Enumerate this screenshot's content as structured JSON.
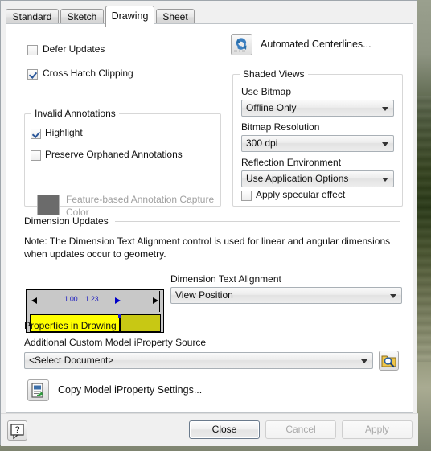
{
  "dialog": {
    "tabs": [
      {
        "label": "Standard",
        "selected": false
      },
      {
        "label": "Sketch",
        "selected": false
      },
      {
        "label": "Drawing",
        "selected": true
      },
      {
        "label": "Sheet",
        "selected": false
      }
    ]
  },
  "drawing": {
    "defer_updates": {
      "label": "Defer Updates",
      "checked": false
    },
    "cross_hatch_clipping": {
      "label": "Cross Hatch Clipping",
      "checked": true
    },
    "automated_centerlines": {
      "label": "Automated Centerlines...",
      "icon": "centerline-refresh-icon"
    },
    "shaded_views": {
      "title": "Shaded Views",
      "use_bitmap": {
        "label": "Use Bitmap",
        "value": "Offline Only"
      },
      "bitmap_resolution": {
        "label": "Bitmap Resolution",
        "value": "300 dpi"
      },
      "reflection_environment": {
        "label": "Reflection Environment",
        "value": "Use Application Options"
      },
      "apply_specular": {
        "label": "Apply specular effect",
        "checked": false
      }
    },
    "invalid_annotations": {
      "title": "Invalid Annotations",
      "highlight": {
        "label": "Highlight",
        "checked": true
      },
      "preserve_orphaned": {
        "label": "Preserve Orphaned Annotations",
        "checked": false
      },
      "capture_color": {
        "label_line1": "Feature-based Annotation Capture",
        "label_line2": "Color",
        "swatch_color": "#6b6b6b",
        "enabled": false
      }
    },
    "dimension_updates": {
      "title": "Dimension Updates",
      "note": "Note: The Dimension Text Alignment control is used for linear and angular dimensions when updates occur to geometry.",
      "preview": {
        "dim_value_a": "1.00",
        "dim_value_b": "1.23",
        "color_left": "#ffff00",
        "color_right": "#c8c814",
        "dim_text_color": "#2020c0"
      },
      "text_alignment": {
        "label": "Dimension Text Alignment",
        "value": "View Position"
      }
    },
    "properties_in_drawing": {
      "title": "Properties in Drawing",
      "iproperty_source": {
        "label": "Additional Custom Model iProperty Source",
        "value": "<Select Document>"
      },
      "browse_button": {
        "icon": "folder-magnifier-icon"
      },
      "copy_settings": {
        "label": "Copy Model iProperty Settings...",
        "icon": "copy-document-icon"
      }
    }
  },
  "footer": {
    "help": {
      "icon": "help-question-icon"
    },
    "close": {
      "label": "Close",
      "enabled": true,
      "default": true
    },
    "cancel": {
      "label": "Cancel",
      "enabled": false
    },
    "apply": {
      "label": "Apply",
      "enabled": false
    }
  }
}
